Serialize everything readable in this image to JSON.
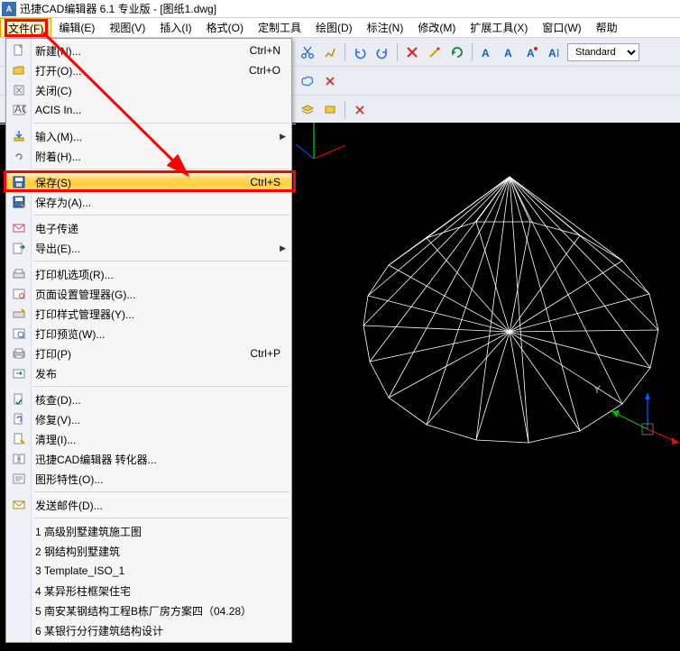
{
  "title": "迅捷CAD编辑器 6.1 专业版  - [图纸1.dwg]",
  "menubar": [
    "文件(F)",
    "编辑(E)",
    "视图(V)",
    "插入(I)",
    "格式(O)",
    "定制工具",
    "绘图(D)",
    "标注(N)",
    "修改(M)",
    "扩展工具(X)",
    "窗口(W)",
    "帮助"
  ],
  "dropdown": {
    "groups": [
      [
        {
          "icon": "new",
          "label": "新建(N)...",
          "shortcut": "Ctrl+N"
        },
        {
          "icon": "open",
          "label": "打开(O)...",
          "shortcut": "Ctrl+O"
        },
        {
          "icon": "close",
          "label": "关闭(C)"
        },
        {
          "icon": "acis",
          "label": "ACIS In..."
        }
      ],
      [
        {
          "icon": "import",
          "label": "输入(M)...",
          "arrow": true
        },
        {
          "icon": "attach",
          "label": "附着(H)..."
        }
      ],
      [
        {
          "icon": "save",
          "label": "保存(S)",
          "shortcut": "Ctrl+S",
          "highlight": true
        },
        {
          "icon": "saveas",
          "label": "保存为(A)..."
        }
      ],
      [
        {
          "icon": "etrans",
          "label": "电子传递"
        },
        {
          "icon": "export",
          "label": "导出(E)...",
          "arrow": true
        }
      ],
      [
        {
          "icon": "popt",
          "label": "打印机选项(R)..."
        },
        {
          "icon": "psetup",
          "label": "页面设置管理器(G)..."
        },
        {
          "icon": "pstyle",
          "label": "打印样式管理器(Y)..."
        },
        {
          "icon": "ppreview",
          "label": "打印预览(W)..."
        },
        {
          "icon": "print",
          "label": "打印(P)",
          "shortcut": "Ctrl+P"
        },
        {
          "icon": "publish",
          "label": "发布"
        }
      ],
      [
        {
          "icon": "audit",
          "label": "核查(D)..."
        },
        {
          "icon": "recover",
          "label": "修复(V)..."
        },
        {
          "icon": "purge",
          "label": "清理(I)..."
        },
        {
          "icon": "convert",
          "label": "迅捷CAD编辑器 转化器..."
        },
        {
          "icon": "props",
          "label": "图形特性(O)..."
        }
      ],
      [
        {
          "icon": "mail",
          "label": "发送邮件(D)..."
        }
      ],
      [
        {
          "icon": "",
          "label": "1 高级别墅建筑施工图"
        },
        {
          "icon": "",
          "label": "2 钢结构别墅建筑"
        },
        {
          "icon": "",
          "label": "3 Template_ISO_1"
        },
        {
          "icon": "",
          "label": "4 某异形柱框架住宅"
        },
        {
          "icon": "",
          "label": "5 南安某钢结构工程B栋厂房方案四（04.28）"
        },
        {
          "icon": "",
          "label": "6 某银行分行建筑结构设计"
        }
      ]
    ]
  },
  "toolbar": {
    "style_select": "Standard"
  },
  "axis": {
    "y_label": "Y"
  }
}
